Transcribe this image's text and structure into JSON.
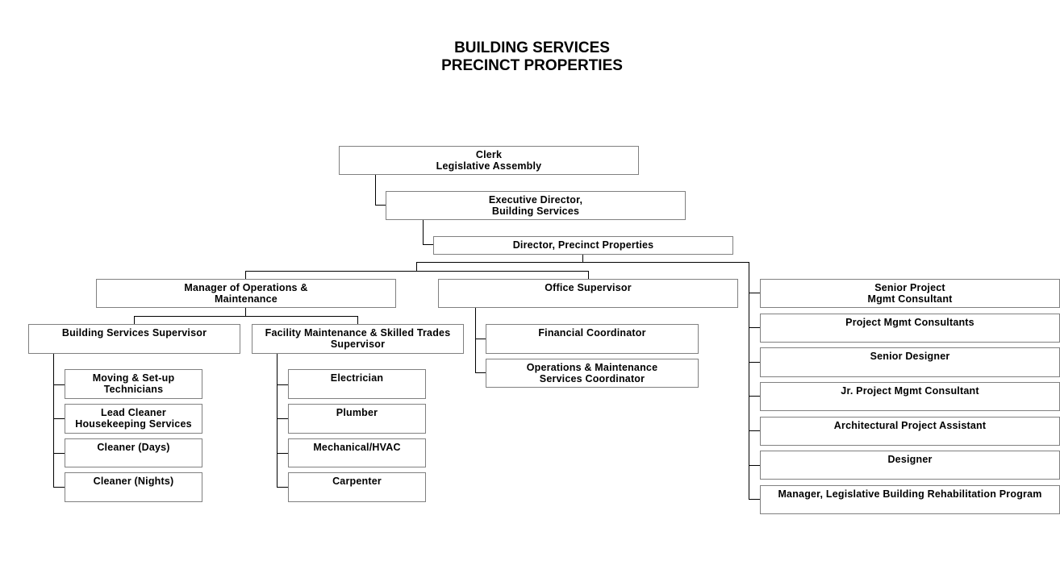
{
  "title": {
    "line1": "BUILDING SERVICES",
    "line2": "PRECINCT PROPERTIES"
  },
  "chart_data": {
    "type": "org-chart",
    "title": "BUILDING SERVICES PRECINCT PROPERTIES",
    "root": {
      "label": [
        "Clerk",
        "Legislative Assembly"
      ],
      "children": [
        {
          "label": [
            "Executive Director,",
            "Building Services"
          ],
          "children": [
            {
              "label": [
                "Director, Precinct Properties"
              ],
              "children": [
                {
                  "label": [
                    "Manager of Operations &",
                    "Maintenance"
                  ],
                  "children": [
                    {
                      "label": [
                        "Building Services Supervisor"
                      ],
                      "children": [
                        {
                          "label": [
                            "Moving & Set-up",
                            "Technicians"
                          ]
                        },
                        {
                          "label": [
                            "Lead Cleaner",
                            "Housekeeping Services"
                          ]
                        },
                        {
                          "label": [
                            "Cleaner (Days)"
                          ]
                        },
                        {
                          "label": [
                            "Cleaner (Nights)"
                          ]
                        }
                      ]
                    },
                    {
                      "label": [
                        "Facility Maintenance & Skilled Trades",
                        "Supervisor"
                      ],
                      "children": [
                        {
                          "label": [
                            "Electrician"
                          ]
                        },
                        {
                          "label": [
                            "Plumber"
                          ]
                        },
                        {
                          "label": [
                            "Mechanical/HVAC"
                          ]
                        },
                        {
                          "label": [
                            "Carpenter"
                          ]
                        }
                      ]
                    }
                  ]
                },
                {
                  "label": [
                    "Office Supervisor"
                  ],
                  "children": [
                    {
                      "label": [
                        "Financial Coordinator"
                      ]
                    },
                    {
                      "label": [
                        "Operations & Maintenance",
                        "Services Coordinator"
                      ]
                    }
                  ]
                },
                {
                  "label": [
                    "Senior Project",
                    "Mgmt Consultant"
                  ]
                },
                {
                  "label": [
                    "Project Mgmt Consultants"
                  ]
                },
                {
                  "label": [
                    "Senior Designer"
                  ]
                },
                {
                  "label": [
                    "Jr. Project Mgmt Consultant"
                  ]
                },
                {
                  "label": [
                    "Architectural Project Assistant"
                  ]
                },
                {
                  "label": [
                    "Designer"
                  ]
                },
                {
                  "label": [
                    "Manager, Legislative Building Rehabilitation Program"
                  ]
                }
              ]
            }
          ]
        }
      ]
    }
  },
  "boxes": {
    "clerk": [
      "Clerk",
      "Legislative Assembly"
    ],
    "exec_director": [
      "Executive Director,",
      "Building Services"
    ],
    "director": [
      "Director, Precinct Properties"
    ],
    "manager_ops": [
      "Manager of Operations &",
      "Maintenance"
    ],
    "office_supervisor": [
      "Office Supervisor"
    ],
    "bldg_services_supervisor": [
      "Building Services Supervisor"
    ],
    "facility_supervisor": [
      "Facility Maintenance & Skilled Trades",
      "Supervisor"
    ],
    "moving_techs": [
      "Moving & Set-up",
      "Technicians"
    ],
    "lead_cleaner": [
      "Lead Cleaner",
      "Housekeeping Services"
    ],
    "cleaner_days": [
      "Cleaner (Days)"
    ],
    "cleaner_nights": [
      "Cleaner (Nights)"
    ],
    "electrician": [
      "Electrician"
    ],
    "plumber": [
      "Plumber"
    ],
    "mechanical_hvac": [
      "Mechanical/HVAC"
    ],
    "carpenter": [
      "Carpenter"
    ],
    "financial_coord": [
      "Financial Coordinator"
    ],
    "om_services_coord": [
      "Operations & Maintenance",
      "Services Coordinator"
    ],
    "senior_pm_consultant": [
      "Senior Project",
      "Mgmt Consultant"
    ],
    "pm_consultants": [
      "Project Mgmt Consultants"
    ],
    "senior_designer": [
      "Senior Designer"
    ],
    "jr_pm_consultant": [
      "Jr. Project Mgmt Consultant"
    ],
    "arch_project_assistant": [
      "Architectural Project Assistant"
    ],
    "designer": [
      "Designer"
    ],
    "mgr_rehab_program": [
      "Manager, Legislative Building Rehabilitation Program"
    ]
  },
  "colors": {
    "box_border": "#808080",
    "connector": "#000000",
    "background": "#ffffff"
  }
}
